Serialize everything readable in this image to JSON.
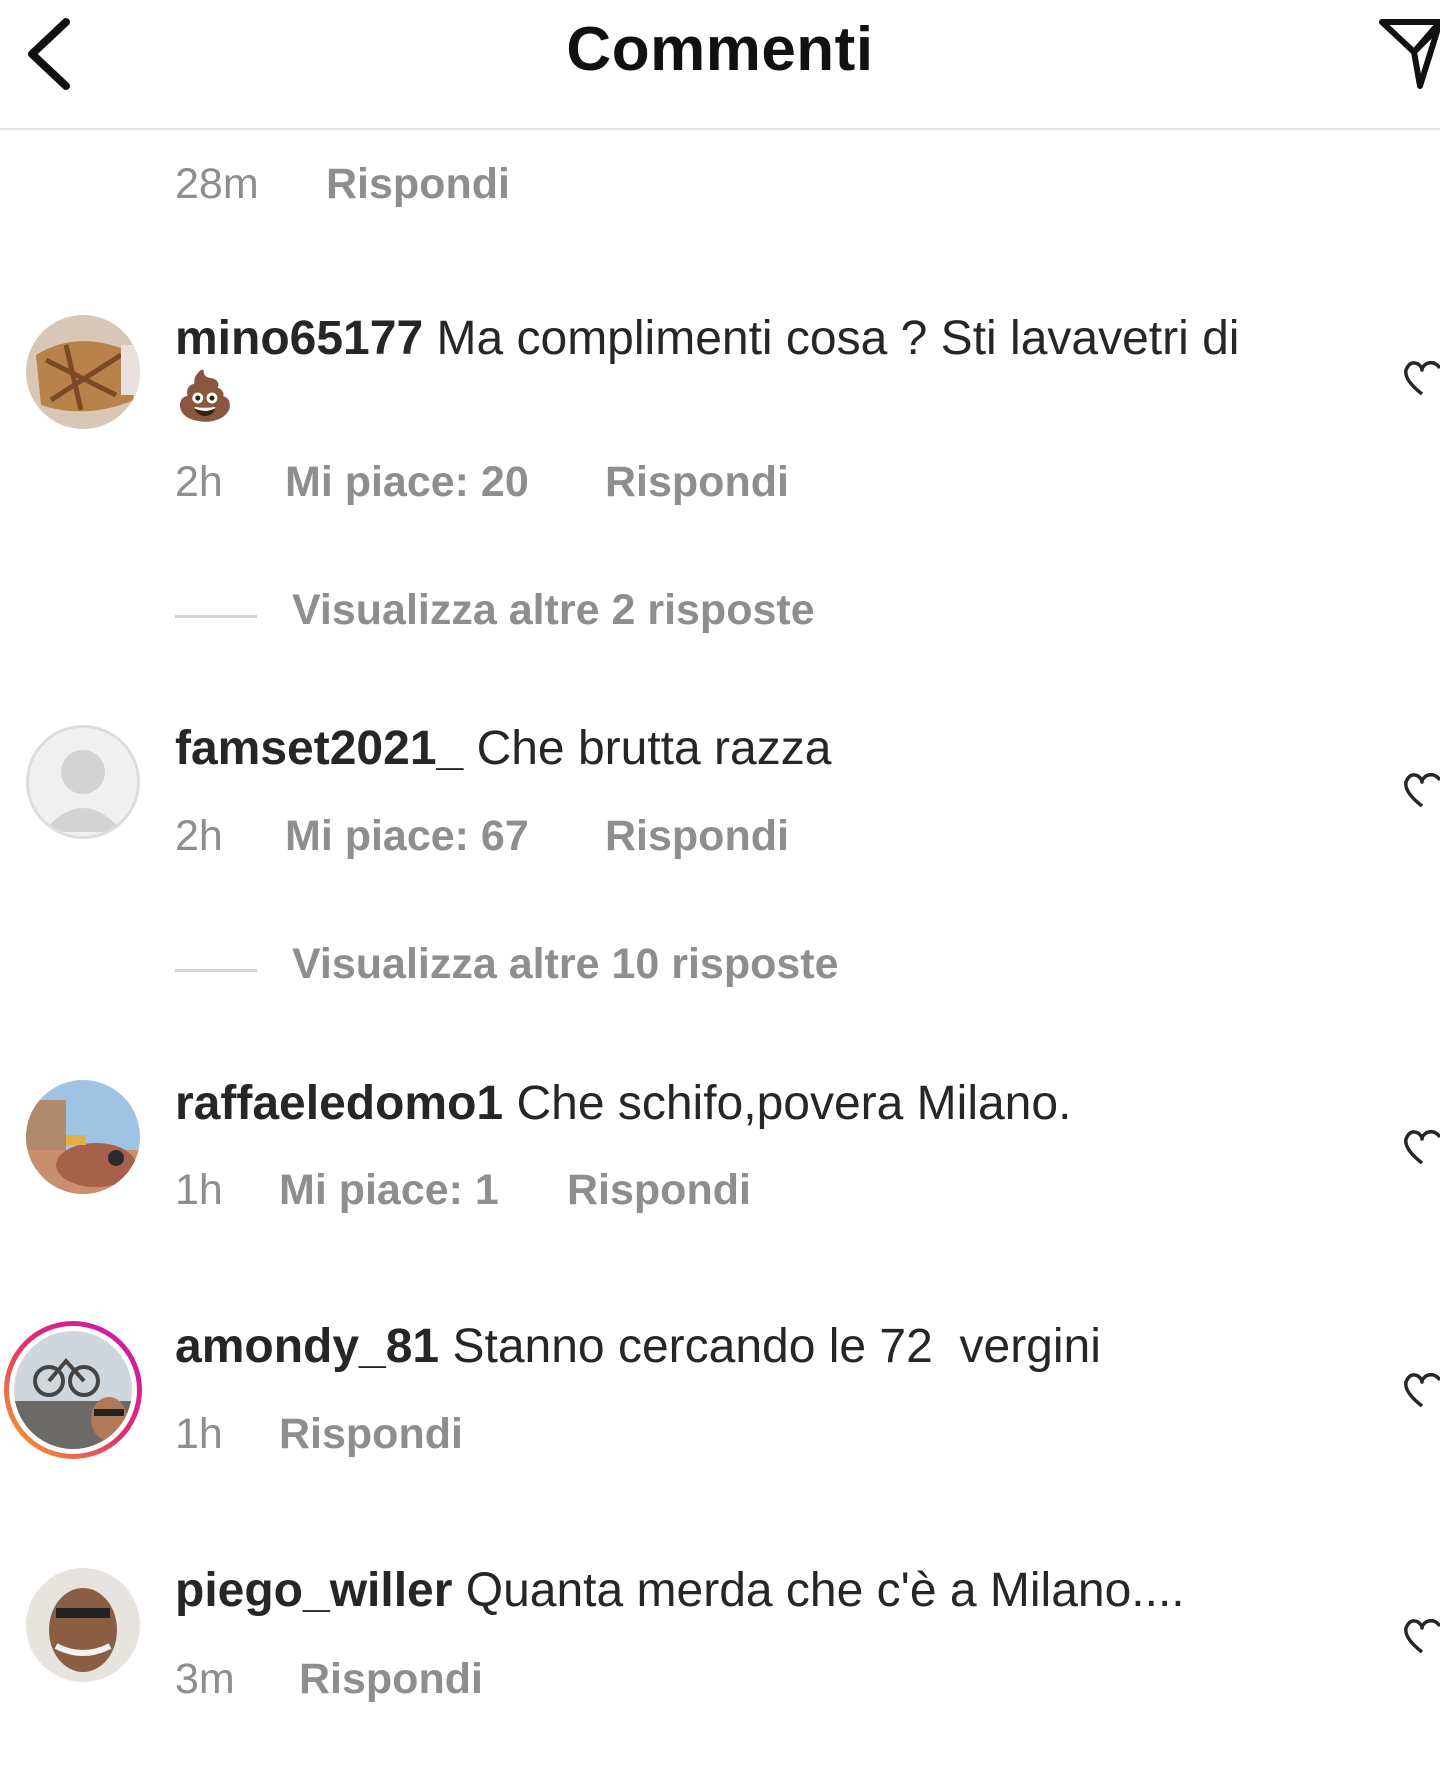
{
  "header": {
    "title": "Commenti",
    "back_icon": "chevron-left-icon",
    "send_icon": "paper-plane-icon"
  },
  "top_meta": {
    "time": "28m",
    "reply": "Rispondi"
  },
  "comments": [
    {
      "username": "mino65177",
      "text": "Ma complimenti cosa ? Sti lavavetri di",
      "emoji": "💩",
      "time": "2h",
      "likes": "Mi piace: 20",
      "reply": "Rispondi",
      "view_replies": "Visualizza altre 2 risposte"
    },
    {
      "username": "famset2021_",
      "text": "Che brutta razza",
      "time": "2h",
      "likes": "Mi piace: 67",
      "reply": "Rispondi",
      "view_replies": "Visualizza altre 10 risposte"
    },
    {
      "username": "raffaeledomo1",
      "text": "Che schifo,povera Milano.",
      "time": "1h",
      "likes": "Mi piace: 1",
      "reply": "Rispondi"
    },
    {
      "username": "amondy_81",
      "text": "Stanno cercando le 72  vergini",
      "time": "1h",
      "reply": "Rispondi"
    },
    {
      "username": "piego_willer",
      "text": "Quanta merda che c'è a Milano....",
      "time": "3m",
      "reply": "Rispondi"
    }
  ],
  "colors": {
    "text": "#262626",
    "secondary": "#8e8e8e",
    "divider": "#e3e3e3",
    "story_ring_start": "#f9a825",
    "story_ring_end": "#c913b9"
  }
}
